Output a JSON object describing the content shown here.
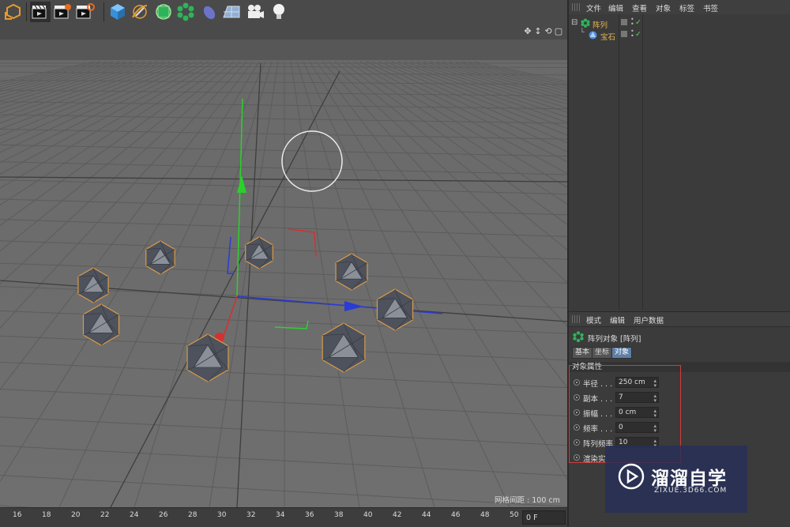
{
  "colors": {
    "accent": "#5e7fa6",
    "highlight_box": "#d13c3c",
    "object_name": "#e6b84a",
    "check": "#5fd35f"
  },
  "toolbar": {
    "icons": [
      "undo-cube-icon",
      "render-view-icon",
      "render-settings-icon",
      "render-queue-icon",
      "cube-primitive-icon",
      "pen-spline-icon",
      "subdivision-icon",
      "array-generator-icon",
      "deformer-icon",
      "floor-environment-icon",
      "camera-icon",
      "light-icon"
    ]
  },
  "viewport": {
    "grid_spacing": "网格间距 : 100 cm"
  },
  "timeline": {
    "ticks": [
      "16",
      "18",
      "20",
      "22",
      "24",
      "26",
      "28",
      "30",
      "32",
      "34",
      "36",
      "38",
      "40",
      "42",
      "44",
      "46",
      "48",
      "50"
    ],
    "frame": "0 F"
  },
  "object_manager": {
    "menu": [
      "文件",
      "编辑",
      "查看",
      "对象",
      "标签",
      "书签"
    ],
    "objects": [
      {
        "name": "阵列",
        "icon": "array-icon"
      },
      {
        "name": "宝石",
        "icon": "gem-icon"
      }
    ]
  },
  "attributes": {
    "menu": [
      "模式",
      "编辑",
      "用户数据"
    ],
    "title": "阵列对象 [阵列]",
    "tabs": [
      "基本",
      "坐标",
      "对象"
    ],
    "active_tab": "对象",
    "section": "对象属性",
    "props": [
      {
        "label": "半径 . . . .",
        "value": "250 cm"
      },
      {
        "label": "副本 . . . .",
        "value": "7"
      },
      {
        "label": "振幅 . . . .",
        "value": "0 cm"
      },
      {
        "label": "频率 . . . .",
        "value": "0"
      },
      {
        "label": "阵列频率",
        "value": "10"
      },
      {
        "label": "渲染实",
        "value": ""
      }
    ]
  },
  "watermark": {
    "title": "溜溜自学",
    "url": "ZIXUE.3D66.COM"
  }
}
